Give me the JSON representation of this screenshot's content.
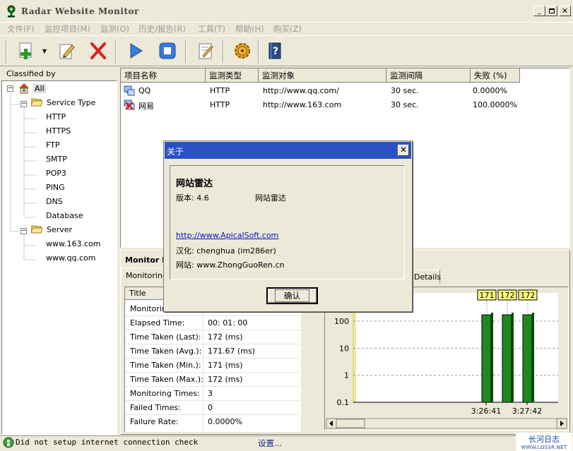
{
  "window": {
    "title": "Radar Website Monitor"
  },
  "menu": [
    "文件(F)",
    "监控项目(M)",
    "监测(O)",
    "历史/报告(R)",
    "工具(T)",
    "帮助(H)",
    "购买(Z)"
  ],
  "toolbar": {
    "icons": [
      "add-icon",
      "dropdown-arrow-icon",
      "edit-icon",
      "delete-icon",
      "start-icon",
      "stop-icon",
      "report-icon",
      "settings-icon",
      "help-icon"
    ]
  },
  "tree": {
    "header": "Classified by",
    "root": "All",
    "groups": [
      {
        "label": "Service Type",
        "items": [
          "HTTP",
          "HTTPS",
          "FTP",
          "SMTP",
          "POP3",
          "PING",
          "DNS",
          "Database"
        ]
      },
      {
        "label": "Server",
        "items": [
          "www.163.com",
          "www.qq.com"
        ]
      }
    ]
  },
  "list": {
    "columns": [
      "项目名称",
      "监测类型",
      "监测对象",
      "监测间隔",
      "失败 (%)"
    ],
    "rows": [
      {
        "name": "QQ",
        "type": "HTTP",
        "target": "http://www.qq.com/",
        "interval": "30 sec.",
        "fail": "0.0000%",
        "status": "ok"
      },
      {
        "name": "网易",
        "type": "HTTP",
        "target": "http://www.163.com",
        "interval": "30 sec.",
        "fail": "100.0000%",
        "status": "error"
      }
    ]
  },
  "monitor": {
    "title": "Monitor I",
    "tab_monitoring": "Monitoring",
    "tab_details": "Details",
    "stats_header": "Title",
    "stats": [
      {
        "label": "Monitorin",
        "value": ""
      },
      {
        "label": "Elapsed Time:",
        "value": "00: 01: 00"
      },
      {
        "label": "Time Taken (Last):",
        "value": "172 (ms)"
      },
      {
        "label": "Time Taken (Avg.):",
        "value": "171.67 (ms)"
      },
      {
        "label": "Time Taken (Min.):",
        "value": "171 (ms)"
      },
      {
        "label": "Time Taken (Max.):",
        "value": "172 (ms)"
      },
      {
        "label": "Monitoring Times:",
        "value": "3"
      },
      {
        "label": "Failed Times:",
        "value": "0"
      },
      {
        "label": "Failure Rate:",
        "value": "0.0000%"
      }
    ]
  },
  "chart_data": {
    "type": "bar",
    "log_scale": true,
    "ylim": [
      0.1,
      100
    ],
    "y_ticks": [
      "100",
      "10",
      "1",
      "0.1"
    ],
    "x_ticks": [
      "3:26:41",
      "3:27:42"
    ],
    "values": [
      171,
      172,
      172
    ],
    "data_labels": [
      "171",
      "172",
      "172"
    ],
    "bar_color": "#1e8a1e",
    "label_bg": "#ffff80"
  },
  "status": {
    "text": "Did not setup internet connection check",
    "setup": "设置...",
    "watermark_top": "长河日志",
    "watermark_bottom": "WWW.LOSSR.NET"
  },
  "dialog": {
    "title": "关于",
    "product": "网站雷达",
    "version": "版本: 4.6",
    "product2": "网站雷达",
    "link": "http://www.ApicalSoft.com",
    "translate": "汉化: chenghua (im286er)",
    "site": "网站: www.ZhongGuoRen.cn",
    "ok": "确认"
  }
}
